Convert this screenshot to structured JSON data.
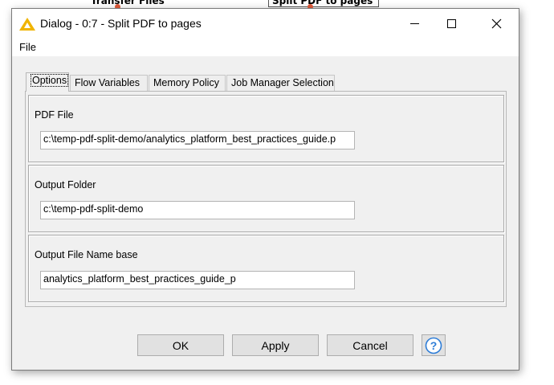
{
  "background": {
    "node1_label": "Transfer Files",
    "node2_label": "Split PDF to pages"
  },
  "window": {
    "title": "Dialog - 0:7 - Split PDF to pages",
    "app_icon": "knime-triangle-icon",
    "controls": [
      "minimize-icon",
      "maximize-icon",
      "close-icon"
    ]
  },
  "menu": {
    "file_label": "File"
  },
  "tabs": [
    {
      "label": "Options",
      "active": true
    },
    {
      "label": "Flow Variables",
      "active": false
    },
    {
      "label": "Memory Policy",
      "active": false
    },
    {
      "label": "Job Manager Selection",
      "active": false
    }
  ],
  "options": {
    "pdf_file": {
      "label": "PDF File",
      "value": "c:\\temp-pdf-split-demo/analytics_platform_best_practices_guide.p"
    },
    "output_folder": {
      "label": "Output Folder",
      "value": "c:\\temp-pdf-split-demo"
    },
    "output_file_name_base": {
      "label": "Output File Name base",
      "value": "analytics_platform_best_practices_guide_p"
    }
  },
  "buttons": {
    "ok": "OK",
    "apply": "Apply",
    "cancel": "Cancel",
    "help": "?",
    "help_icon": "help-icon"
  },
  "colors": {
    "accent": "#2e7dd7",
    "node_port": "#e05a3a",
    "app_icon": "#f0b400"
  }
}
